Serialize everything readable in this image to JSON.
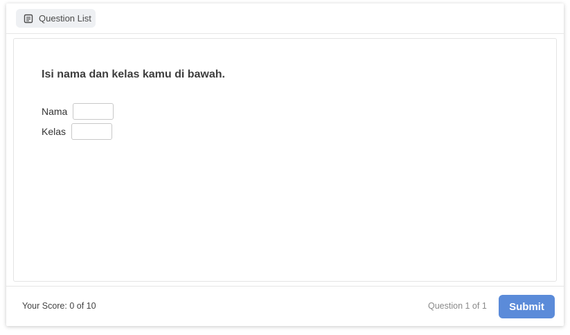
{
  "topbar": {
    "question_list_label": "Question List",
    "question_list_icon": "list-doc-icon"
  },
  "question": {
    "text": "Isi nama dan kelas kamu di bawah.",
    "fields": [
      {
        "label": "Nama",
        "value": ""
      },
      {
        "label": "Kelas",
        "value": ""
      }
    ]
  },
  "footer": {
    "score_text": "Your Score: 0 of 10",
    "question_counter": "Question 1 of 1",
    "submit_label": "Submit"
  },
  "colors": {
    "accent": "#5b8bd9",
    "button_bg": "#eef0f3"
  }
}
